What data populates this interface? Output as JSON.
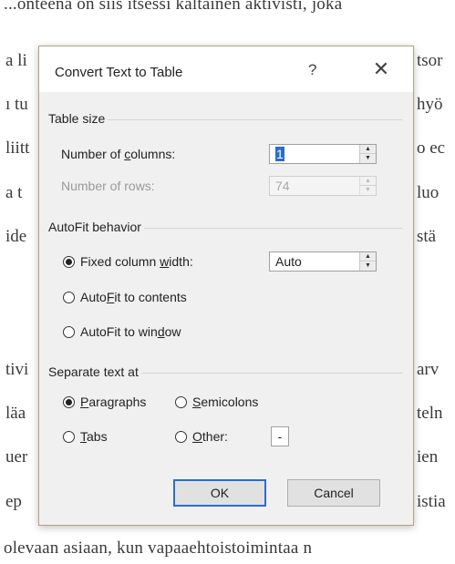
{
  "document": {
    "lines": [
      "...onteena on siis itsessi kaltainen aktivisti, joka"
    ],
    "left_fragments": [
      "a li",
      "ı tu",
      "liitt",
      "a t",
      "ide",
      "tivi",
      "läa",
      "uer",
      "ep"
    ],
    "right_fragments": [
      "tsor",
      "hyö",
      "o ec",
      "luo",
      "stä",
      "arv",
      "teln",
      "ien",
      "istia"
    ],
    "bottom_line": "olevaan asiaan, kun vapaaehtoistoimintaa n"
  },
  "dialog": {
    "title": "Convert Text to Table",
    "help_label": "?",
    "close_label": "✕",
    "table_size": {
      "section_label": "Table size",
      "columns_label_pre": "Number of ",
      "columns_label_acc": "c",
      "columns_label_post": "olumns:",
      "columns_value": "1",
      "rows_label": "Number of rows:",
      "rows_value": "74"
    },
    "autofit": {
      "section_label": "AutoFit behavior",
      "fixed_pre": "Fixed column ",
      "fixed_acc": "w",
      "fixed_post": "idth:",
      "fixed_value": "Auto",
      "contents_pre": "Auto",
      "contents_acc": "F",
      "contents_post": "it to contents",
      "window_pre": "AutoFit to win",
      "window_acc": "d",
      "window_post": "ow",
      "selected": "fixed"
    },
    "separate": {
      "section_label": "Separate text at",
      "paragraphs_acc": "P",
      "paragraphs_post": "aragraphs",
      "semicolons_acc": "S",
      "semicolons_post": "emicolons",
      "tabs_acc": "T",
      "tabs_post": "abs",
      "other_acc": "O",
      "other_post": "ther:",
      "other_value": "-",
      "selected": "paragraphs"
    },
    "ok_label": "OK",
    "cancel_label": "Cancel"
  }
}
